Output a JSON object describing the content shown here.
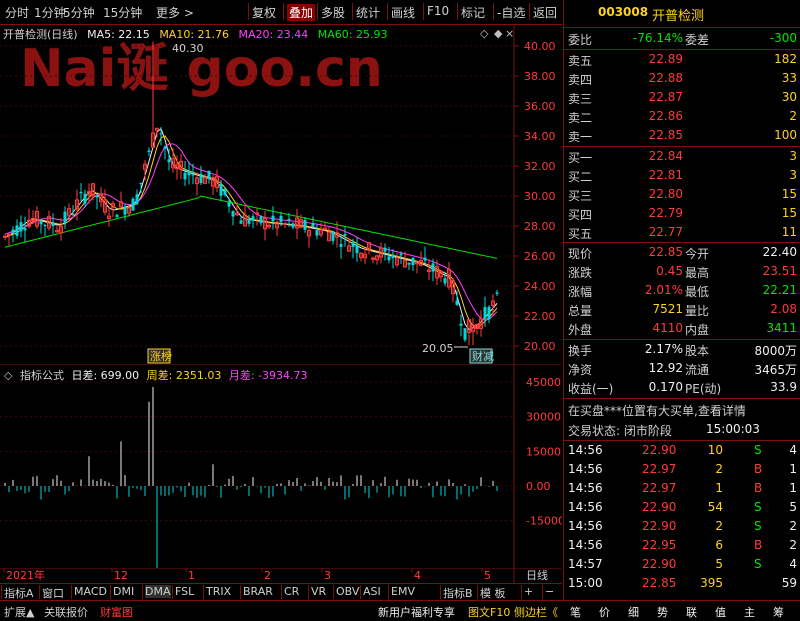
{
  "toolbar": {
    "left": [
      "分时",
      "1分钟",
      "5分钟",
      "15分钟",
      "更多 >"
    ],
    "right": [
      "复权",
      "叠加",
      "多股",
      "统计",
      "画线",
      "F10",
      "标记",
      "-自选",
      "返回"
    ],
    "active": "叠加"
  },
  "chart": {
    "name": "开普检测(日线)",
    "ma": [
      {
        "label": "MA5: 22.15",
        "color": "#f0f0f0"
      },
      {
        "label": "MA10: 21.76",
        "color": "#ffd21e"
      },
      {
        "label": "MA20: 23.44",
        "color": "#ff40ff"
      },
      {
        "label": "MA60: 25.93",
        "color": "#00e400"
      }
    ],
    "price_ticks": [
      "40.00",
      "38.00",
      "36.00",
      "34.00",
      "32.00",
      "30.00",
      "28.00",
      "26.00",
      "24.00",
      "22.00",
      "20.00"
    ],
    "high_label": "40.30",
    "low_label": "20.05",
    "badge_left": "涨榜",
    "badge_right": "财减",
    "watermark": "Nai诞 goo.cn"
  },
  "indicator": {
    "name": "指标公式",
    "items": [
      {
        "label": "日差: 699.00",
        "color": "#f0f0f0"
      },
      {
        "label": "周差: 2351.03",
        "color": "#ffd21e"
      },
      {
        "label": "月差: -3934.73",
        "color": "#ff40ff"
      }
    ],
    "ticks": [
      "45000",
      "30000",
      "15000",
      "0.00",
      "-15000"
    ]
  },
  "x_axis": [
    "2021年",
    "12",
    "1",
    "2",
    "3",
    "4",
    "5"
  ],
  "x_axis_right": "日线",
  "bottom_tabs": [
    "指标A",
    "窗口",
    "MACD",
    "DMI",
    "DMA",
    "FSL",
    "TRIX",
    "BRAR",
    "CR",
    "VR",
    "OBV",
    "ASI",
    "EMV",
    "指标B",
    "模 板",
    "+",
    "−"
  ],
  "status": {
    "left": [
      "扩展▲",
      "关联报价",
      "财富图"
    ],
    "right": [
      "新用户福利专享",
      "图文F10",
      "侧边栏《"
    ],
    "tabs": [
      "笔",
      "价",
      "细",
      "势",
      "联",
      "值",
      "主",
      "筹"
    ]
  },
  "quote": {
    "code": "003008",
    "name": "开普检测",
    "weibi_label": "委比",
    "weibi": "-76.14%",
    "weicha_label": "委差",
    "weicha": "-300",
    "sell": [
      {
        "label": "卖五",
        "price": "22.89",
        "vol": "182"
      },
      {
        "label": "卖四",
        "price": "22.88",
        "vol": "33"
      },
      {
        "label": "卖三",
        "price": "22.87",
        "vol": "30"
      },
      {
        "label": "卖二",
        "price": "22.86",
        "vol": "2"
      },
      {
        "label": "卖一",
        "price": "22.85",
        "vol": "100"
      }
    ],
    "buy": [
      {
        "label": "买一",
        "price": "22.84",
        "vol": "3"
      },
      {
        "label": "买二",
        "price": "22.81",
        "vol": "3"
      },
      {
        "label": "买三",
        "price": "22.80",
        "vol": "15"
      },
      {
        "label": "买四",
        "price": "22.79",
        "vol": "15"
      },
      {
        "label": "买五",
        "price": "22.77",
        "vol": "11"
      }
    ],
    "stats": [
      {
        "l1": "现价",
        "v1": "22.85",
        "c1": "red",
        "l2": "今开",
        "v2": "22.40",
        "c2": "white"
      },
      {
        "l1": "涨跌",
        "v1": "0.45",
        "c1": "red",
        "l2": "最高",
        "v2": "23.51",
        "c2": "red"
      },
      {
        "l1": "涨幅",
        "v1": "2.01%",
        "c1": "red",
        "l2": "最低",
        "v2": "22.21",
        "c2": "green"
      },
      {
        "l1": "总量",
        "v1": "7521",
        "c1": "yellow",
        "l2": "量比",
        "v2": "2.08",
        "c2": "red"
      },
      {
        "l1": "外盘",
        "v1": "4110",
        "c1": "red",
        "l2": "内盘",
        "v2": "3411",
        "c2": "green"
      }
    ],
    "stats2": [
      {
        "l1": "换手",
        "v1": "2.17%",
        "l2": "股本",
        "v2": "8000万"
      },
      {
        "l1": "净资",
        "v1": "12.92",
        "l2": "流通",
        "v2": "3465万"
      },
      {
        "l1": "收益(一)",
        "v1": "0.170",
        "l2": "PE(动)",
        "v2": "33.9"
      }
    ],
    "notice": "在买盘***位置有大买单,查看详情",
    "trade_status_label": "交易状态: 闭市阶段",
    "trade_status_time": "15:00:03",
    "ticks": [
      {
        "t": "14:56",
        "p": "22.90",
        "v": "10",
        "s": "S",
        "n": "4"
      },
      {
        "t": "14:56",
        "p": "22.97",
        "v": "2",
        "s": "B",
        "n": "1"
      },
      {
        "t": "14:56",
        "p": "22.97",
        "v": "1",
        "s": "B",
        "n": "1"
      },
      {
        "t": "14:56",
        "p": "22.90",
        "v": "54",
        "s": "S",
        "n": "5"
      },
      {
        "t": "14:56",
        "p": "22.90",
        "v": "2",
        "s": "S",
        "n": "2"
      },
      {
        "t": "14:56",
        "p": "22.95",
        "v": "6",
        "s": "B",
        "n": "2"
      },
      {
        "t": "14:57",
        "p": "22.90",
        "v": "5",
        "s": "S",
        "n": "4"
      },
      {
        "t": "15:00",
        "p": "22.85",
        "v": "395",
        "s": "",
        "n": "59"
      }
    ]
  }
}
